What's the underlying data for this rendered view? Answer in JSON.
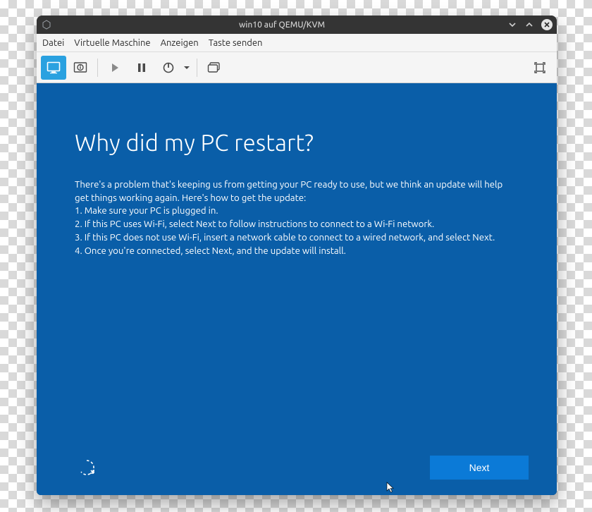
{
  "titlebar": {
    "title": "win10 auf QEMU/KVM"
  },
  "menubar": {
    "items": [
      "Datei",
      "Virtuelle Maschine",
      "Anzeigen",
      "Taste senden"
    ]
  },
  "toolbar": {
    "icons": {
      "monitor": "monitor-icon",
      "info_panel": "info-panel-icon",
      "play": "play-icon",
      "pause": "pause-icon",
      "power": "power-icon",
      "snapshot": "snapshot-icon",
      "fullscreen": "fullscreen-icon"
    }
  },
  "oobe": {
    "heading": "Why did my PC restart?",
    "intro": "There's a problem that's keeping us from getting your PC ready to use, but we think an update will help get things working again. Here's how to get the update:",
    "step1": "1. Make sure your PC is plugged in.",
    "step2": "2. If this PC uses Wi-Fi, select Next to follow instructions to connect to a Wi-Fi network.",
    "step3": "3. If this PC does not use Wi-Fi, insert a network cable to connect to a wired network, and select Next.",
    "step4": "4. Once you're connected, select Next, and the update will install.",
    "next_label": "Next"
  },
  "colors": {
    "oobe_bg": "#0a5ea8",
    "next_btn": "#0b7ad7",
    "toolbar_active": "#2aa1e0"
  }
}
